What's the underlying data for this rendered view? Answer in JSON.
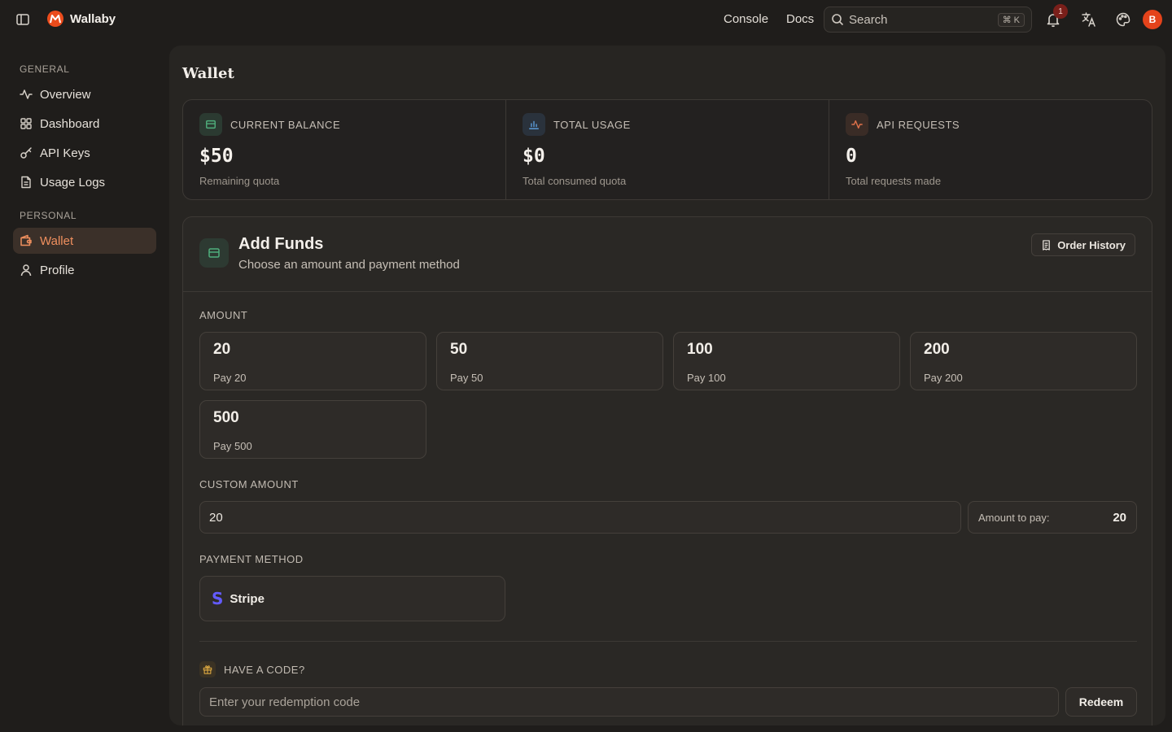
{
  "app": {
    "name": "Wallaby",
    "avatar_initial": "B",
    "notification_count": "1"
  },
  "topnav": {
    "console": "Console",
    "docs": "Docs",
    "search_label": "Search",
    "search_shortcut": "⌘ K"
  },
  "sidebar": {
    "groups": [
      {
        "label": "GENERAL",
        "items": [
          {
            "label": "Overview",
            "icon": "activity-icon"
          },
          {
            "label": "Dashboard",
            "icon": "grid-icon"
          },
          {
            "label": "API Keys",
            "icon": "key-icon"
          },
          {
            "label": "Usage Logs",
            "icon": "file-text-icon"
          }
        ]
      },
      {
        "label": "PERSONAL",
        "items": [
          {
            "label": "Wallet",
            "icon": "wallet-icon",
            "active": true
          },
          {
            "label": "Profile",
            "icon": "user-icon"
          }
        ]
      }
    ]
  },
  "page": {
    "title": "Wallet"
  },
  "stats": [
    {
      "label": "CURRENT BALANCE",
      "value": "$50",
      "sub": "Remaining quota",
      "icon": "wallet-icon",
      "color": "#4fae7c"
    },
    {
      "label": "TOTAL USAGE",
      "value": "$0",
      "sub": "Total consumed quota",
      "icon": "bar-chart-icon",
      "color": "#5b9bd8"
    },
    {
      "label": "API REQUESTS",
      "value": "0",
      "sub": "Total requests made",
      "icon": "activity-icon",
      "color": "#e0714a"
    }
  ],
  "funds": {
    "title": "Add Funds",
    "subtitle": "Choose an amount and payment method",
    "order_history": "Order History",
    "amount_label": "AMOUNT",
    "amounts": [
      {
        "value": "20",
        "pay": "Pay 20"
      },
      {
        "value": "50",
        "pay": "Pay 50"
      },
      {
        "value": "100",
        "pay": "Pay 100"
      },
      {
        "value": "200",
        "pay": "Pay 200"
      },
      {
        "value": "500",
        "pay": "Pay 500"
      }
    ],
    "custom_label": "CUSTOM AMOUNT",
    "custom_value": "20",
    "pay_label": "Amount to pay:",
    "pay_value": "20",
    "payment_label": "PAYMENT METHOD",
    "payment_method": "Stripe",
    "code_label": "HAVE A CODE?",
    "code_placeholder": "Enter your redemption code",
    "redeem": "Redeem"
  }
}
